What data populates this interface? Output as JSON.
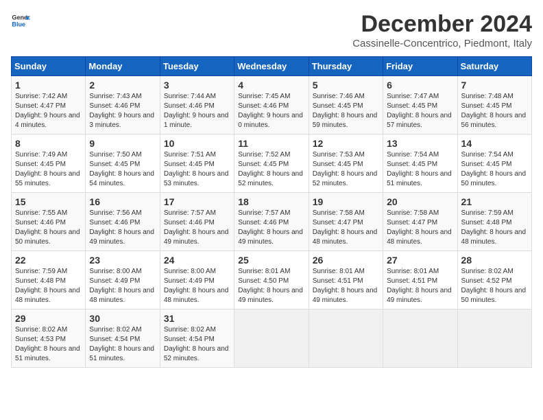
{
  "header": {
    "logo_general": "General",
    "logo_blue": "Blue",
    "title": "December 2024",
    "subtitle": "Cassinelle-Concentrico, Piedmont, Italy"
  },
  "calendar": {
    "days_of_week": [
      "Sunday",
      "Monday",
      "Tuesday",
      "Wednesday",
      "Thursday",
      "Friday",
      "Saturday"
    ],
    "weeks": [
      [
        {
          "day": "1",
          "sunrise": "7:42 AM",
          "sunset": "4:47 PM",
          "daylight": "9 hours and 4 minutes."
        },
        {
          "day": "2",
          "sunrise": "7:43 AM",
          "sunset": "4:46 PM",
          "daylight": "9 hours and 3 minutes."
        },
        {
          "day": "3",
          "sunrise": "7:44 AM",
          "sunset": "4:46 PM",
          "daylight": "9 hours and 1 minute."
        },
        {
          "day": "4",
          "sunrise": "7:45 AM",
          "sunset": "4:46 PM",
          "daylight": "9 hours and 0 minutes."
        },
        {
          "day": "5",
          "sunrise": "7:46 AM",
          "sunset": "4:45 PM",
          "daylight": "8 hours and 59 minutes."
        },
        {
          "day": "6",
          "sunrise": "7:47 AM",
          "sunset": "4:45 PM",
          "daylight": "8 hours and 57 minutes."
        },
        {
          "day": "7",
          "sunrise": "7:48 AM",
          "sunset": "4:45 PM",
          "daylight": "8 hours and 56 minutes."
        }
      ],
      [
        {
          "day": "8",
          "sunrise": "7:49 AM",
          "sunset": "4:45 PM",
          "daylight": "8 hours and 55 minutes."
        },
        {
          "day": "9",
          "sunrise": "7:50 AM",
          "sunset": "4:45 PM",
          "daylight": "8 hours and 54 minutes."
        },
        {
          "day": "10",
          "sunrise": "7:51 AM",
          "sunset": "4:45 PM",
          "daylight": "8 hours and 53 minutes."
        },
        {
          "day": "11",
          "sunrise": "7:52 AM",
          "sunset": "4:45 PM",
          "daylight": "8 hours and 52 minutes."
        },
        {
          "day": "12",
          "sunrise": "7:53 AM",
          "sunset": "4:45 PM",
          "daylight": "8 hours and 52 minutes."
        },
        {
          "day": "13",
          "sunrise": "7:54 AM",
          "sunset": "4:45 PM",
          "daylight": "8 hours and 51 minutes."
        },
        {
          "day": "14",
          "sunrise": "7:54 AM",
          "sunset": "4:45 PM",
          "daylight": "8 hours and 50 minutes."
        }
      ],
      [
        {
          "day": "15",
          "sunrise": "7:55 AM",
          "sunset": "4:46 PM",
          "daylight": "8 hours and 50 minutes."
        },
        {
          "day": "16",
          "sunrise": "7:56 AM",
          "sunset": "4:46 PM",
          "daylight": "8 hours and 49 minutes."
        },
        {
          "day": "17",
          "sunrise": "7:57 AM",
          "sunset": "4:46 PM",
          "daylight": "8 hours and 49 minutes."
        },
        {
          "day": "18",
          "sunrise": "7:57 AM",
          "sunset": "4:46 PM",
          "daylight": "8 hours and 49 minutes."
        },
        {
          "day": "19",
          "sunrise": "7:58 AM",
          "sunset": "4:47 PM",
          "daylight": "8 hours and 48 minutes."
        },
        {
          "day": "20",
          "sunrise": "7:58 AM",
          "sunset": "4:47 PM",
          "daylight": "8 hours and 48 minutes."
        },
        {
          "day": "21",
          "sunrise": "7:59 AM",
          "sunset": "4:48 PM",
          "daylight": "8 hours and 48 minutes."
        }
      ],
      [
        {
          "day": "22",
          "sunrise": "7:59 AM",
          "sunset": "4:48 PM",
          "daylight": "8 hours and 48 minutes."
        },
        {
          "day": "23",
          "sunrise": "8:00 AM",
          "sunset": "4:49 PM",
          "daylight": "8 hours and 48 minutes."
        },
        {
          "day": "24",
          "sunrise": "8:00 AM",
          "sunset": "4:49 PM",
          "daylight": "8 hours and 48 minutes."
        },
        {
          "day": "25",
          "sunrise": "8:01 AM",
          "sunset": "4:50 PM",
          "daylight": "8 hours and 49 minutes."
        },
        {
          "day": "26",
          "sunrise": "8:01 AM",
          "sunset": "4:51 PM",
          "daylight": "8 hours and 49 minutes."
        },
        {
          "day": "27",
          "sunrise": "8:01 AM",
          "sunset": "4:51 PM",
          "daylight": "8 hours and 49 minutes."
        },
        {
          "day": "28",
          "sunrise": "8:02 AM",
          "sunset": "4:52 PM",
          "daylight": "8 hours and 50 minutes."
        }
      ],
      [
        {
          "day": "29",
          "sunrise": "8:02 AM",
          "sunset": "4:53 PM",
          "daylight": "8 hours and 51 minutes."
        },
        {
          "day": "30",
          "sunrise": "8:02 AM",
          "sunset": "4:54 PM",
          "daylight": "8 hours and 51 minutes."
        },
        {
          "day": "31",
          "sunrise": "8:02 AM",
          "sunset": "4:54 PM",
          "daylight": "8 hours and 52 minutes."
        },
        null,
        null,
        null,
        null
      ]
    ]
  },
  "labels": {
    "sunrise_label": "Sunrise:",
    "sunset_label": "Sunset:",
    "daylight_label": "Daylight:"
  }
}
